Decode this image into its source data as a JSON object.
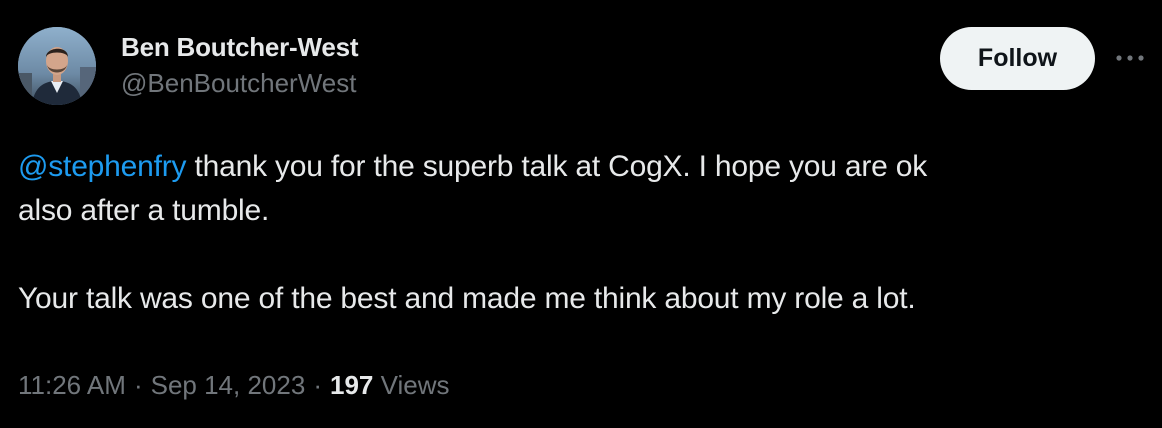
{
  "author": {
    "display_name": "Ben Boutcher-West",
    "handle": "@BenBoutcherWest"
  },
  "follow_label": "Follow",
  "more_icon": "more-horizontal-icon",
  "tweet": {
    "mention": "@stephenfry",
    "line1_rest": " thank you for the superb talk at CogX. I hope you are ok",
    "line2": "also after a tumble.",
    "line3": "Your talk was one of the best and made me think about my role a lot."
  },
  "meta": {
    "time": "11:26 AM",
    "date": "Sep 14, 2023",
    "separator": "·",
    "views_count": "197",
    "views_label": "Views"
  },
  "colors": {
    "background": "#000000",
    "text": "#e7e9ea",
    "secondary": "#71767b",
    "link": "#1d9bf0",
    "follow_bg": "#eff3f4"
  }
}
